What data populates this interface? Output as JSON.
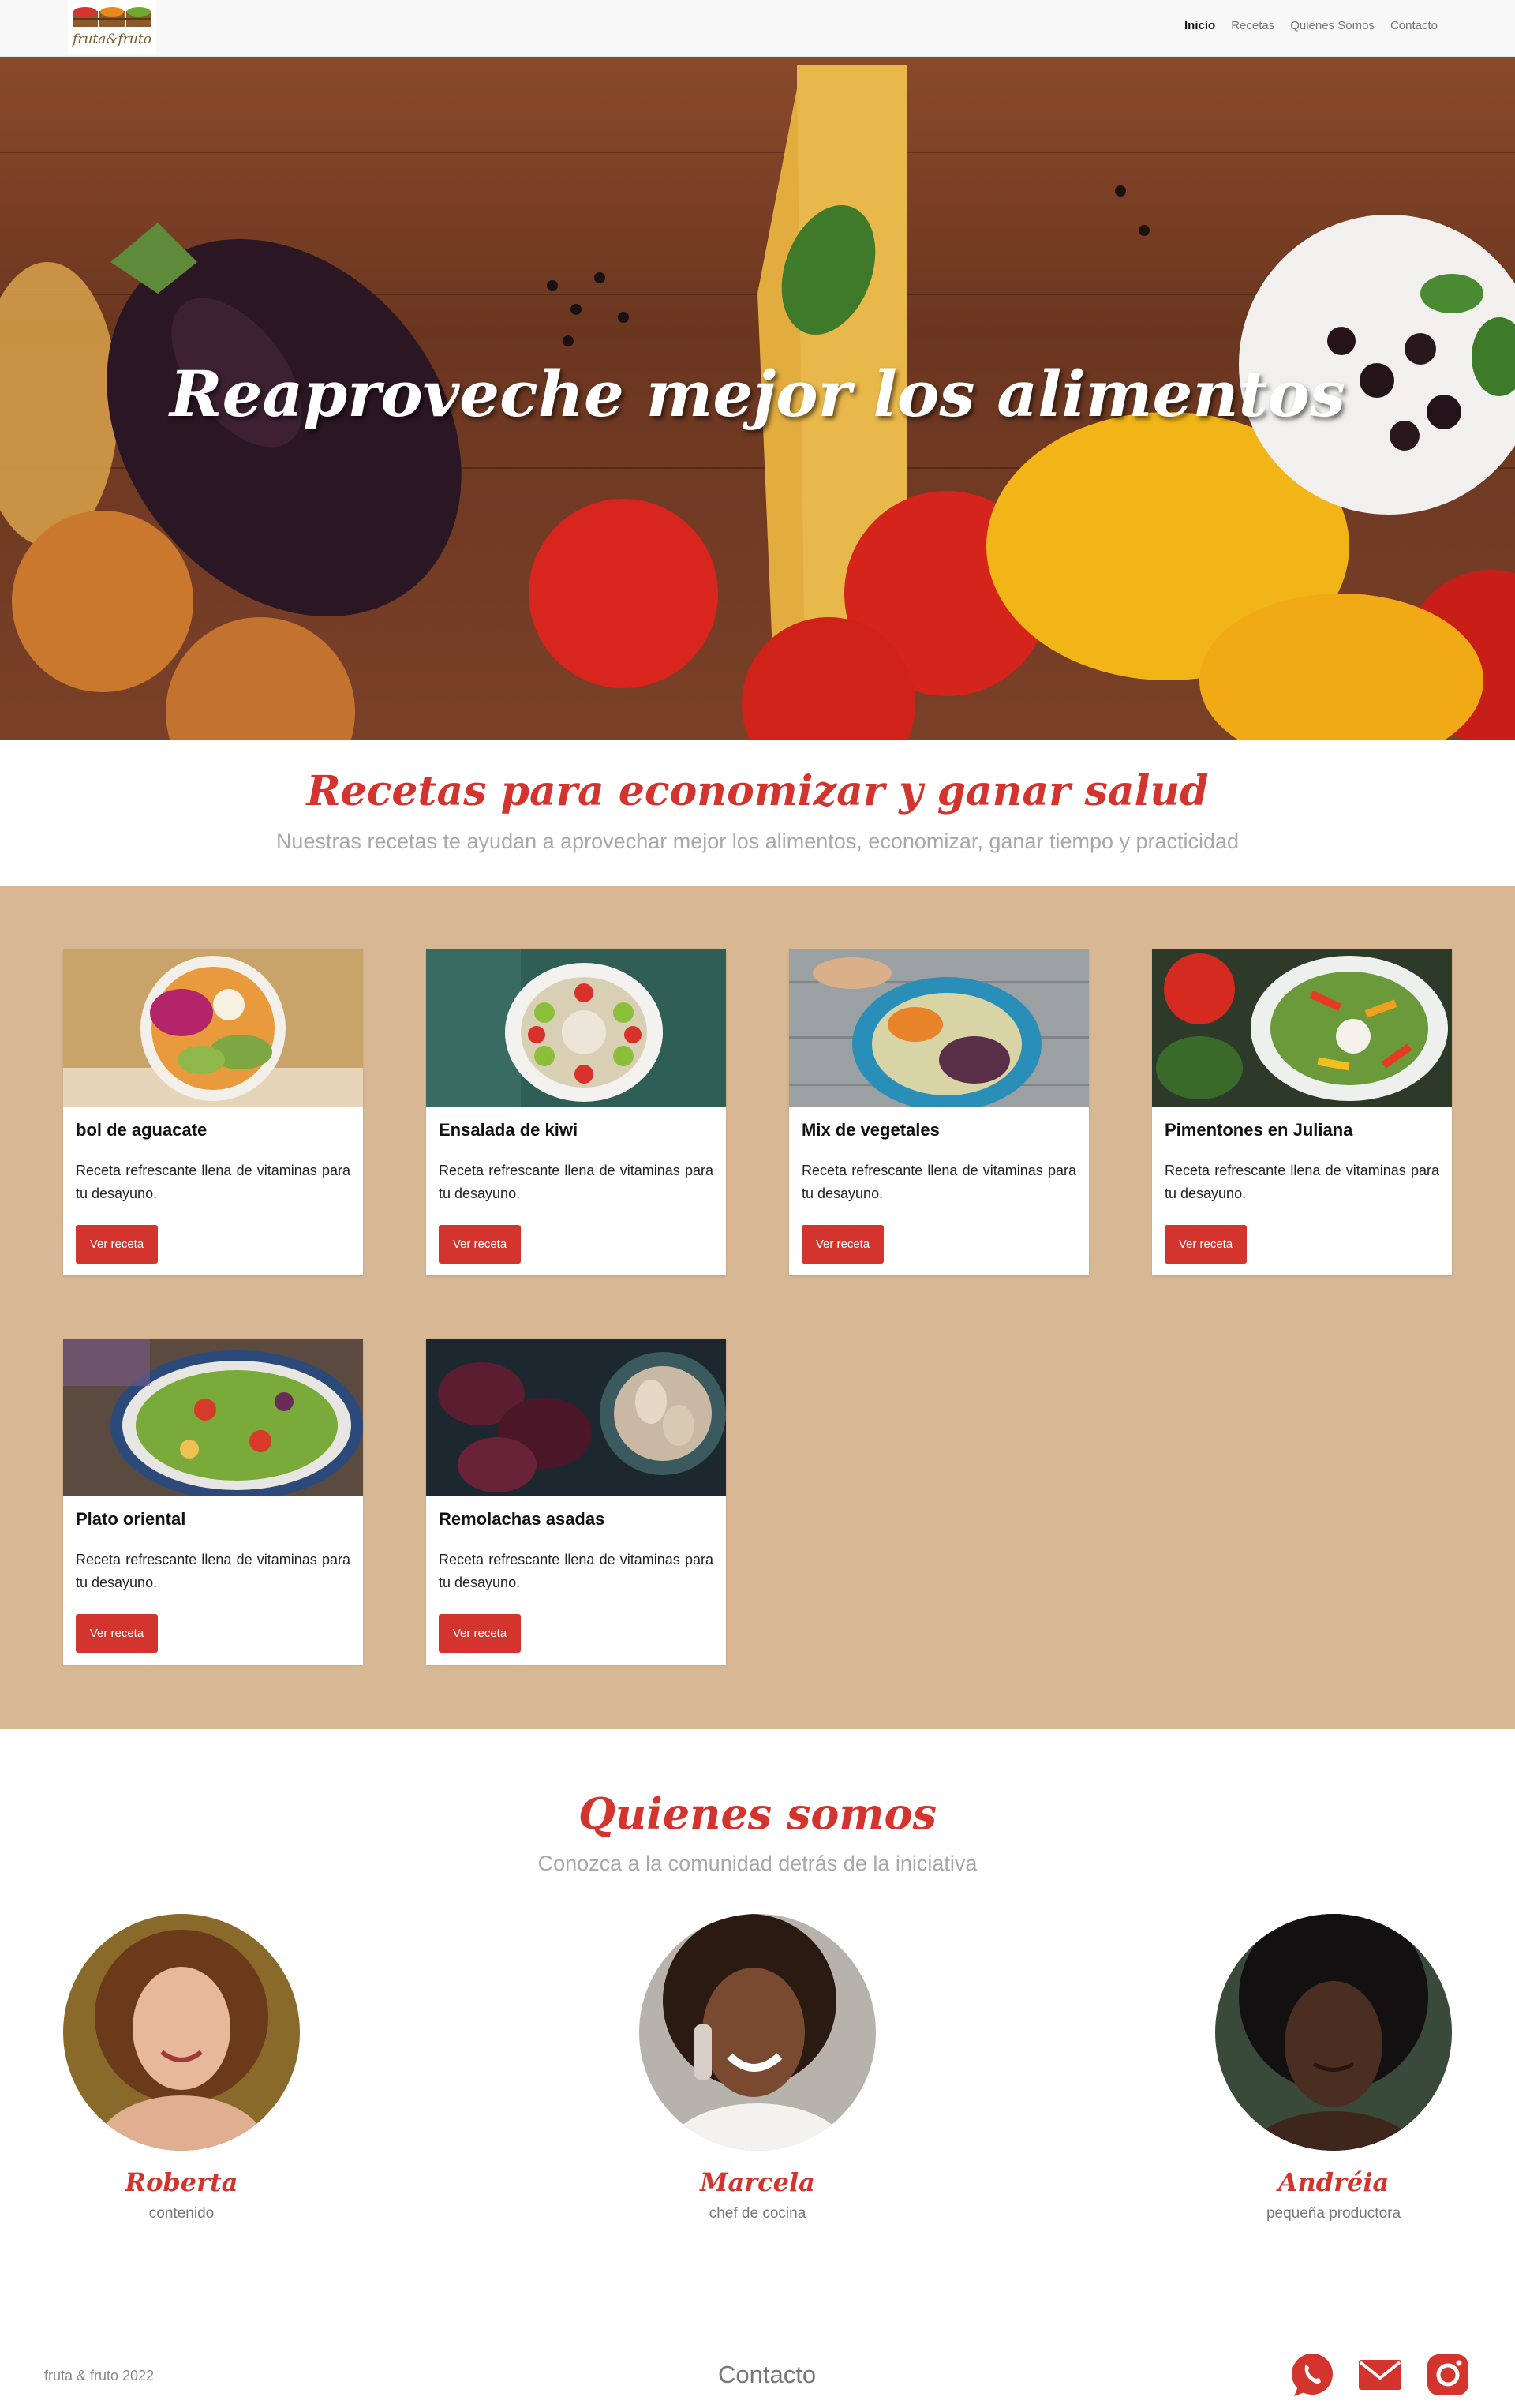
{
  "brand": {
    "logo_text": "fruta&fruto"
  },
  "nav": {
    "links": [
      "Inicio",
      "Recetas",
      "Quienes Somos",
      "Contacto"
    ],
    "active": "Inicio"
  },
  "hero": {
    "title": "Reaproveche mejor los alimentos"
  },
  "recipes": {
    "title": "Recetas para economizar y ganar salud",
    "subtitle": "Nuestras recetas te ayudan a aprovechar mejor los alimentos, economizar, ganar tiempo y practicidad",
    "cards": [
      {
        "title": "bol de aguacate",
        "text": "Receta refrescante llena de vitaminas para tu desayuno.",
        "button": "Ver receta"
      },
      {
        "title": "Ensalada de kiwi",
        "text": "Receta refrescante llena de vitaminas para tu desayuno.",
        "button": "Ver receta"
      },
      {
        "title": "Mix de vegetales",
        "text": "Receta refrescante llena de vitaminas para tu desayuno.",
        "button": "Ver receta"
      },
      {
        "title": "Pimentones en Juliana",
        "text": "Receta refrescante llena de vitaminas para tu desayuno.",
        "button": "Ver receta"
      },
      {
        "title": "Plato oriental",
        "text": "Receta refrescante llena de vitaminas para tu desayuno.",
        "button": "Ver receta"
      },
      {
        "title": "Remolachas asadas",
        "text": "Receta refrescante llena de vitaminas para tu desayuno.",
        "button": "Ver receta"
      }
    ]
  },
  "about": {
    "title": "Quienes somos",
    "subtitle": "Conozca a la comunidad detrás de la iniciativa",
    "members": [
      {
        "name": "Roberta",
        "role": "contenido"
      },
      {
        "name": "Marcela",
        "role": "chef de cocina"
      },
      {
        "name": "Andréia",
        "role": "pequeña productora"
      }
    ]
  },
  "footer": {
    "copyright": "fruta & fruto 2022",
    "contact_label": "Contacto",
    "icons": [
      "whatsapp-icon",
      "mail-icon",
      "instagram-icon"
    ]
  },
  "colors": {
    "accent": "#d3352e",
    "band": "#d8b794",
    "nav_bg": "#f8f8f8"
  }
}
